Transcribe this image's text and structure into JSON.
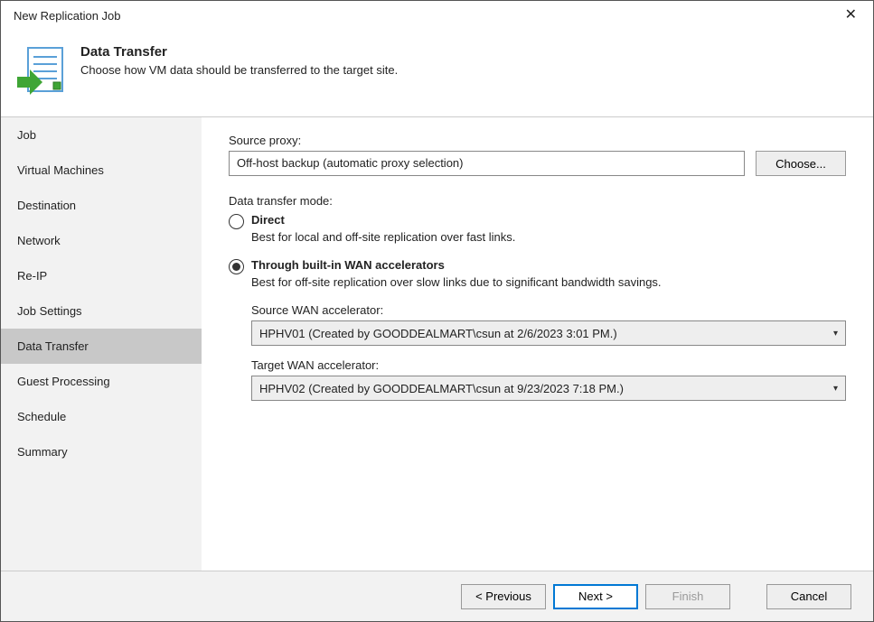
{
  "window": {
    "title": "New Replication Job"
  },
  "header": {
    "title": "Data Transfer",
    "subtitle": "Choose how VM data should be transferred to the target site."
  },
  "sidebar": {
    "items": [
      {
        "label": "Job",
        "active": false
      },
      {
        "label": "Virtual Machines",
        "active": false
      },
      {
        "label": "Destination",
        "active": false
      },
      {
        "label": "Network",
        "active": false
      },
      {
        "label": "Re-IP",
        "active": false
      },
      {
        "label": "Job Settings",
        "active": false
      },
      {
        "label": "Data Transfer",
        "active": true
      },
      {
        "label": "Guest Processing",
        "active": false
      },
      {
        "label": "Schedule",
        "active": false
      },
      {
        "label": "Summary",
        "active": false
      }
    ]
  },
  "main": {
    "source_proxy_label": "Source proxy:",
    "source_proxy_value": "Off-host backup (automatic proxy selection)",
    "choose_button": "Choose...",
    "transfer_mode_label": "Data transfer mode:",
    "direct": {
      "title": "Direct",
      "desc": "Best for local and off-site replication over fast links."
    },
    "wan": {
      "title": "Through built-in WAN accelerators",
      "desc": "Best for off-site replication over slow links due to significant bandwidth savings.",
      "source_label": "Source WAN accelerator:",
      "source_value": "HPHV01 (Created by GOODDEALMART\\csun at 2/6/2023 3:01 PM.)",
      "target_label": "Target WAN accelerator:",
      "target_value": "HPHV02 (Created by GOODDEALMART\\csun at 9/23/2023 7:18 PM.)"
    }
  },
  "footer": {
    "previous": "< Previous",
    "next": "Next >",
    "finish": "Finish",
    "cancel": "Cancel"
  }
}
